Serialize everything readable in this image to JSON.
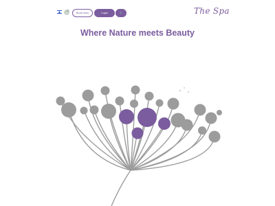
{
  "header": {
    "lang_code": "IT",
    "book_now_label": "Book Now",
    "login_label": "Login",
    "cart_icon": "cart-icon",
    "logo_text": "The Spa"
  },
  "hero": {
    "headline": "Where Nature meets Beauty"
  },
  "colors": {
    "accent": "#7b5c9e",
    "grey": "#9c9c9c",
    "background": "#ffffff"
  }
}
